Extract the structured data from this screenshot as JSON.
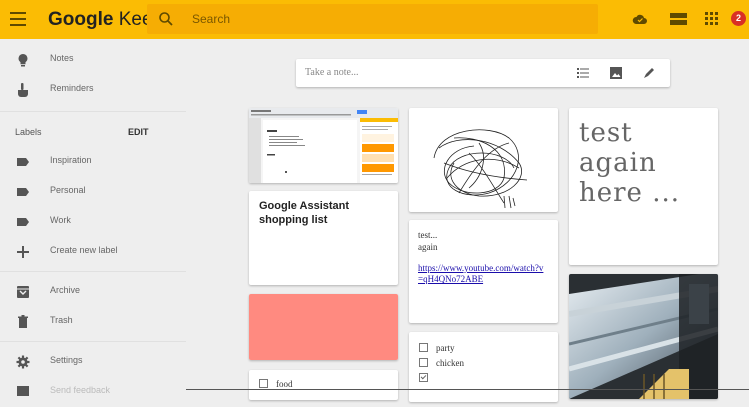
{
  "header": {
    "brand_prefix": "Google",
    "brand_suffix": " Keep",
    "search_placeholder": "Search",
    "notification_count": "2"
  },
  "sidebar": {
    "items": [
      {
        "label": "Notes",
        "icon": "lightbulb-icon"
      },
      {
        "label": "Reminders",
        "icon": "reminder-hand-icon"
      }
    ],
    "labels_heading": "Labels",
    "edit_label": "EDIT",
    "labels": [
      {
        "label": "Inspiration",
        "icon": "label-icon"
      },
      {
        "label": "Personal",
        "icon": "label-icon"
      },
      {
        "label": "Work",
        "icon": "label-icon"
      },
      {
        "label": "Create new label",
        "icon": "plus-icon"
      }
    ],
    "bottom_items": [
      {
        "label": "Archive",
        "icon": "archive-icon"
      },
      {
        "label": "Trash",
        "icon": "trash-icon"
      },
      {
        "label": "Settings",
        "icon": "gear-icon"
      },
      {
        "label": "Send feedback",
        "icon": "feedback-icon"
      }
    ]
  },
  "composer": {
    "placeholder": "Take a note..."
  },
  "notes": {
    "shopping_title": "Google Assistant shopping list",
    "test_lines": [
      "test...",
      "again"
    ],
    "test_link": "https://www.youtube.com/watch?v=qH4QNo72ABE",
    "big_note_lines": [
      "test",
      "again",
      "here ..."
    ],
    "checklist_a": [
      {
        "text": "party",
        "checked": false
      },
      {
        "text": "chicken",
        "checked": false
      },
      {
        "text": "",
        "checked": true
      }
    ],
    "checklist_b": [
      {
        "text": "food",
        "checked": false
      }
    ],
    "salmon_color": "#ff8a80"
  },
  "colors": {
    "accent": "#fbbc04",
    "search": "#f6ad04",
    "badge": "#d93025"
  }
}
